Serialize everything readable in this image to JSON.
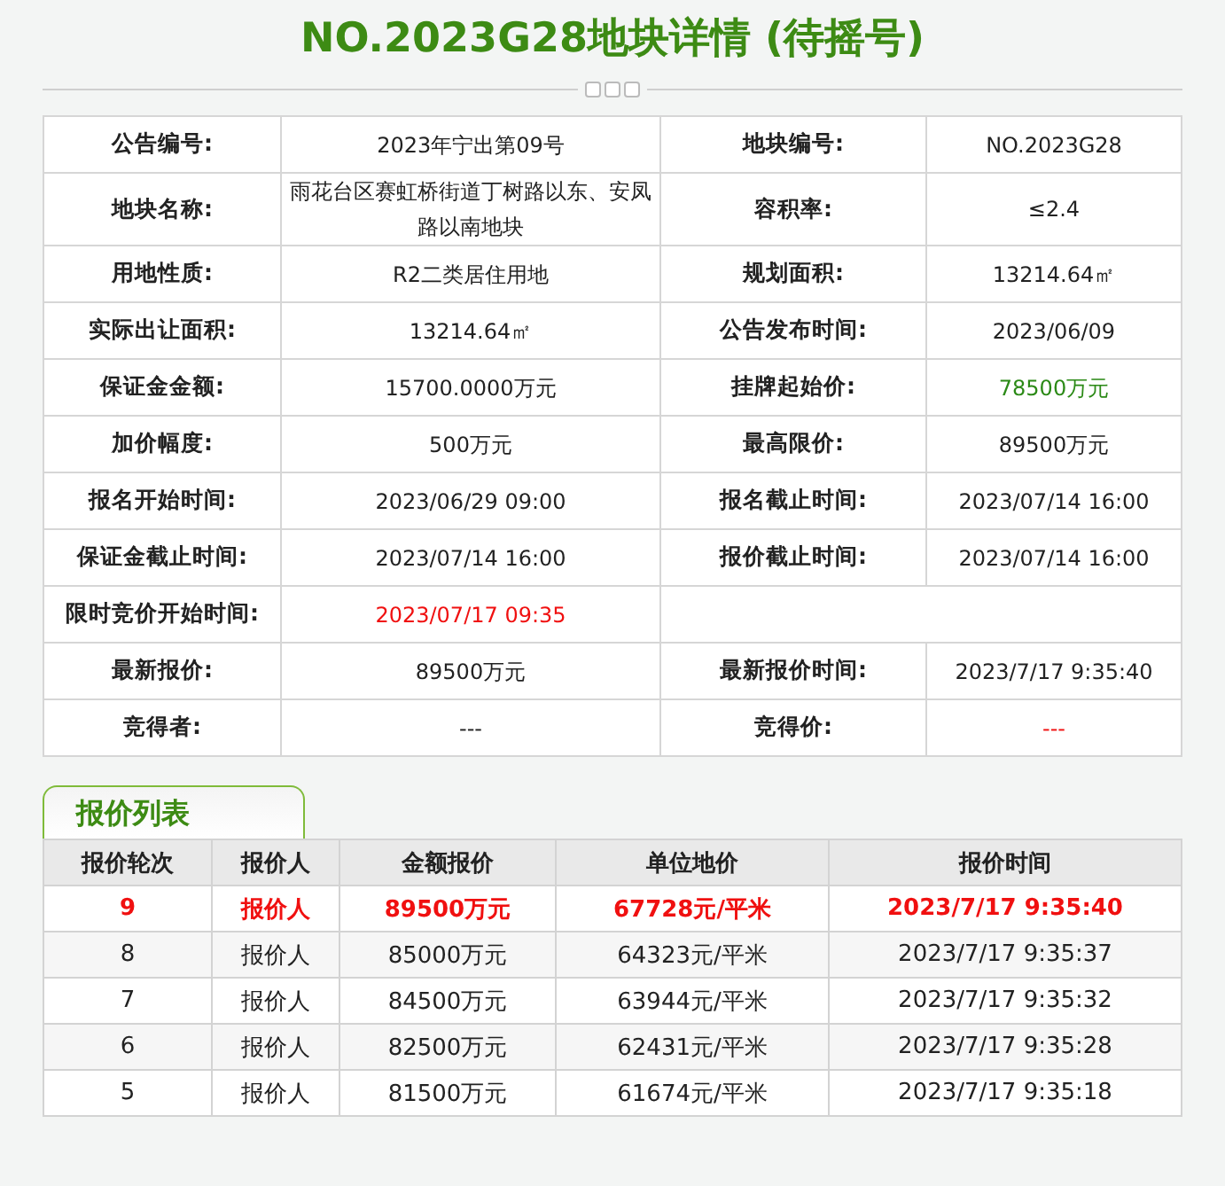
{
  "title": "NO.2023G28地块详情 (待摇号)",
  "info_rows": [
    {
      "cells": [
        {
          "label": "公告编号:",
          "value": "2023年宁出第09号"
        },
        {
          "label": "地块编号:",
          "value": "NO.2023G28"
        }
      ]
    },
    {
      "cells": [
        {
          "label": "地块名称:",
          "value": "雨花台区赛虹桥街道丁树路以东、安凤路以南地块"
        },
        {
          "label": "容积率:",
          "value": "≤2.4"
        }
      ]
    },
    {
      "cells": [
        {
          "label": "用地性质:",
          "value": "R2二类居住用地"
        },
        {
          "label": "规划面积:",
          "value": "13214.64㎡"
        }
      ]
    },
    {
      "cells": [
        {
          "label": "实际出让面积:",
          "value": "13214.64㎡"
        },
        {
          "label": "公告发布时间:",
          "value": "2023/06/09"
        }
      ]
    },
    {
      "cells": [
        {
          "label": "保证金金额:",
          "value": "15700.0000万元"
        },
        {
          "label": "挂牌起始价:",
          "value": "78500万元",
          "color": "#2c8a17"
        }
      ]
    },
    {
      "cells": [
        {
          "label": "加价幅度:",
          "value": "500万元"
        },
        {
          "label": "最高限价:",
          "value": "89500万元"
        }
      ]
    },
    {
      "cells": [
        {
          "label": "报名开始时间:",
          "value": "2023/06/29 09:00"
        },
        {
          "label": "报名截止时间:",
          "value": "2023/07/14 16:00"
        }
      ]
    },
    {
      "cells": [
        {
          "label": "保证金截止时间:",
          "value": "2023/07/14 16:00"
        },
        {
          "label": "报价截止时间:",
          "value": "2023/07/14 16:00"
        }
      ]
    },
    {
      "cells": [
        {
          "label": "限时竞价开始时间:",
          "value": "2023/07/17 09:35",
          "color": "#f01010"
        }
      ]
    },
    {
      "cells": [
        {
          "label": "最新报价:",
          "value": "89500万元"
        },
        {
          "label": "最新报价时间:",
          "value": "2023/7/17 9:35:40"
        }
      ]
    },
    {
      "cells": [
        {
          "label": "竞得者:",
          "value": "---"
        },
        {
          "label": "竞得价:",
          "value": "---",
          "color": "#f01010"
        }
      ]
    }
  ],
  "bids": {
    "tab": "报价列表",
    "columns": [
      "报价轮次",
      "报价人",
      "金额报价",
      "单位地价",
      "报价时间"
    ],
    "rows": [
      {
        "latest": true,
        "cells": [
          "9",
          "报价人",
          "89500万元",
          "67728元/平米",
          "2023/7/17 9:35:40"
        ]
      },
      {
        "latest": false,
        "cells": [
          "8",
          "报价人",
          "85000万元",
          "64323元/平米",
          "2023/7/17 9:35:37"
        ]
      },
      {
        "latest": false,
        "cells": [
          "7",
          "报价人",
          "84500万元",
          "63944元/平米",
          "2023/7/17 9:35:32"
        ]
      },
      {
        "latest": false,
        "cells": [
          "6",
          "报价人",
          "82500万元",
          "62431元/平米",
          "2023/7/17 9:35:28"
        ]
      },
      {
        "latest": false,
        "cells": [
          "5",
          "报价人",
          "81500万元",
          "61674元/平米",
          "2023/7/17 9:35:18"
        ]
      }
    ]
  }
}
